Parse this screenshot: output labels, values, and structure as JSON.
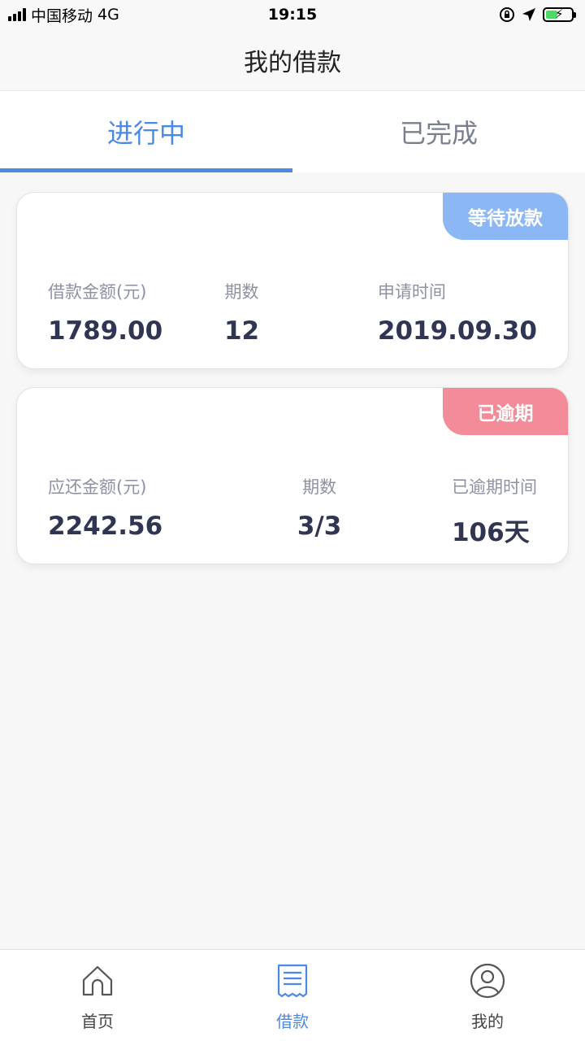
{
  "status_bar": {
    "carrier": "中国移动",
    "network": "4G",
    "time": "19:15"
  },
  "nav": {
    "title": "我的借款"
  },
  "tabs": [
    {
      "label": "进行中",
      "active": true
    },
    {
      "label": "已完成",
      "active": false
    }
  ],
  "loans": [
    {
      "status": "等待放款",
      "status_color": "#8cb7f5",
      "fields": [
        {
          "label": "借款金额(元)",
          "value": "1789.00"
        },
        {
          "label": "期数",
          "value": "12"
        },
        {
          "label": "申请时间",
          "value": "2019.09.30"
        }
      ]
    },
    {
      "status": "已逾期",
      "status_color": "#f38b98",
      "fields": [
        {
          "label": "应还金额(元)",
          "value": "2242.56"
        },
        {
          "label": "期数",
          "value": "3/3"
        },
        {
          "label": "已逾期时间",
          "value": "106天"
        }
      ]
    }
  ],
  "tab_bar": [
    {
      "label": "首页",
      "icon": "home-icon",
      "active": false
    },
    {
      "label": "借款",
      "icon": "receipt-icon",
      "active": true
    },
    {
      "label": "我的",
      "icon": "user-icon",
      "active": false
    }
  ],
  "colors": {
    "accent": "#4a8ae6",
    "waiting": "#8cb7f5",
    "overdue": "#f38b98"
  }
}
